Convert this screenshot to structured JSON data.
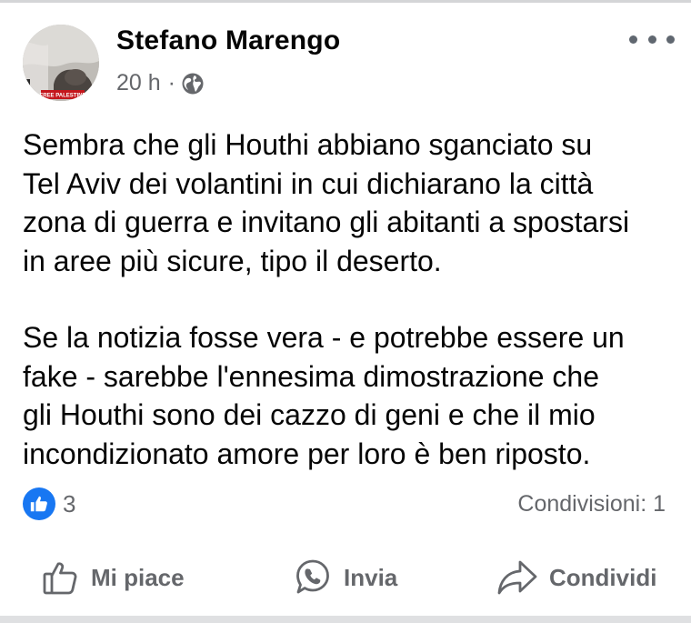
{
  "post": {
    "author_name": "Stefano Marengo",
    "timestamp": "20 h",
    "separator": "·",
    "privacy_icon": "globe-icon",
    "avatar_badge_text": "FREE PALESTINE",
    "paragraphs": [
      [
        "Sembra che gli Houthi abbiano sganciato su",
        "Tel Aviv dei volantini in cui dichiarano la città",
        "zona di guerra e invitano gli abitanti a spostarsi",
        "in aree più sicure, tipo il deserto."
      ],
      [
        "Se la notizia fosse vera - e potrebbe essere un",
        "fake - sarebbe l'ennesima dimostrazione che",
        "gli Houthi sono dei cazzo di geni e che il mio",
        "incondizionato amore per loro è ben riposto."
      ]
    ],
    "reaction_count": "3",
    "shares_text": "Condivisioni: 1"
  },
  "actions": {
    "like_label": "Mi piace",
    "send_label": "Invia",
    "share_label": "Condividi"
  },
  "icons": {
    "more": "more-options-icon",
    "like": "thumbs-up-icon",
    "send": "whatsapp-icon",
    "share": "share-arrow-icon"
  },
  "colors": {
    "primary_text": "#050505",
    "secondary_text": "#65676b",
    "like_blue": "#1877f2"
  }
}
